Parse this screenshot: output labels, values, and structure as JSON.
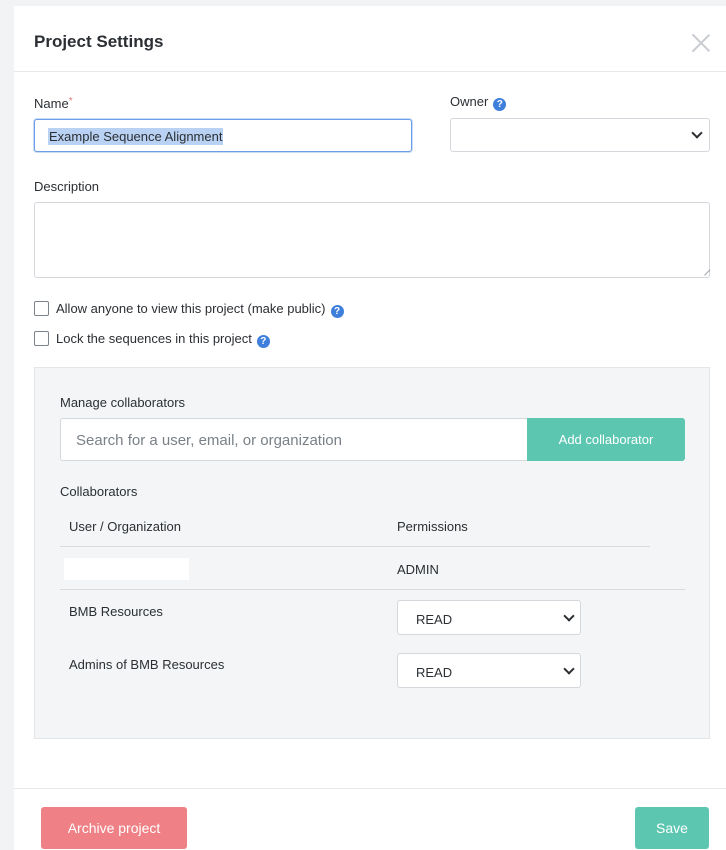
{
  "modal": {
    "title": "Project Settings"
  },
  "form": {
    "name_label": "Name",
    "name_required_mark": "*",
    "name_value": "Example Sequence Alignment",
    "owner_label": "Owner",
    "owner_value": "",
    "description_label": "Description",
    "description_value": "",
    "make_public_label": "Allow anyone to view this project (make public)",
    "make_public_checked": false,
    "lock_sequences_label": "Lock the sequences in this project",
    "lock_sequences_checked": false
  },
  "collaborators": {
    "manage_label": "Manage collaborators",
    "search_placeholder": "Search for a user, email, or organization",
    "add_button": "Add collaborator",
    "section_label": "Collaborators",
    "col_user": "User / Organization",
    "col_permissions": "Permissions",
    "rows": [
      {
        "name": "",
        "permission": "ADMIN"
      },
      {
        "name": "BMB Resources",
        "permission": "READ"
      },
      {
        "name": "Admins of BMB Resources",
        "permission": "READ"
      }
    ]
  },
  "footer": {
    "archive_button": "Archive project",
    "save_button": "Save"
  },
  "colors": {
    "accent_teal": "#5cc6b0",
    "danger_pink": "#ef8085",
    "help_blue": "#3f7fdc"
  },
  "icons": {
    "close": "close-icon",
    "help": "help-icon",
    "dropdown": "chevron-down-icon",
    "resize": "resize-grip-icon"
  }
}
